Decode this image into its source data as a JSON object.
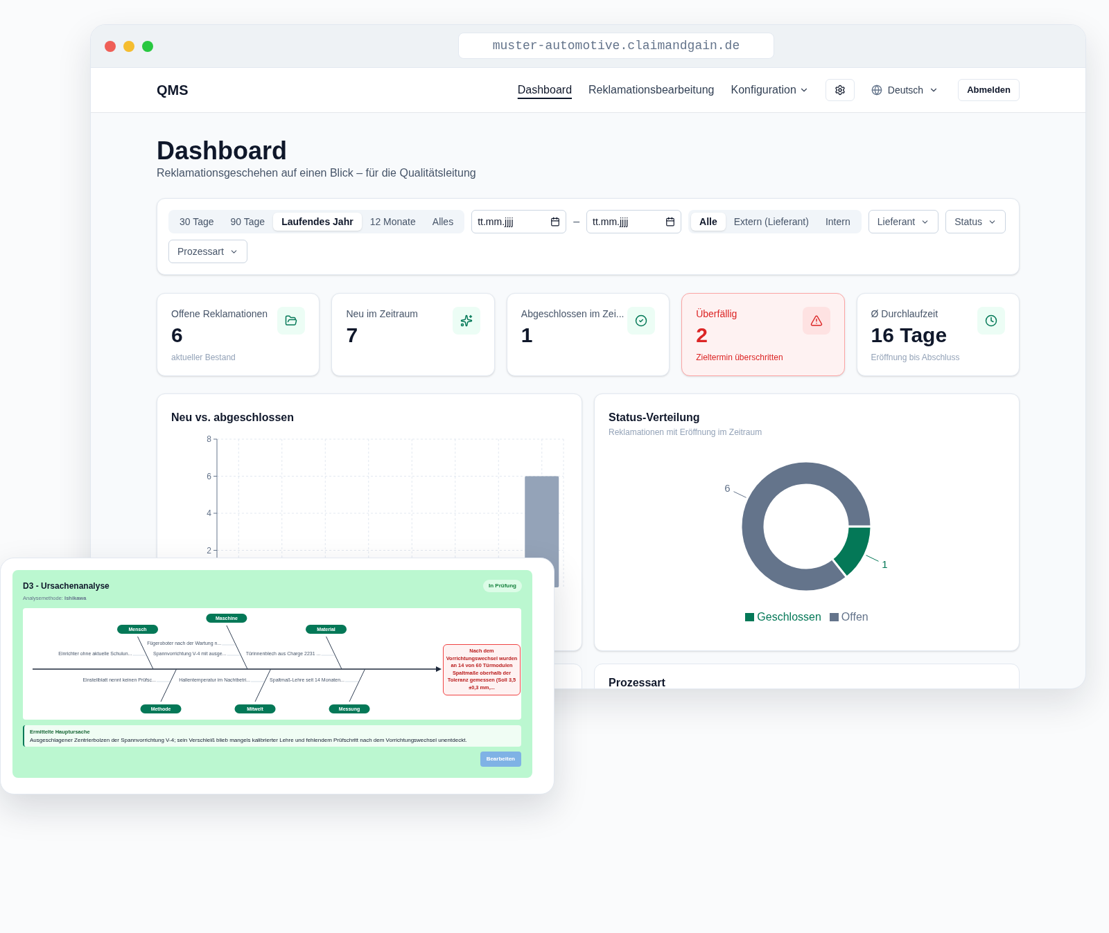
{
  "browser": {
    "url": "muster-automotive.claimandgain.de"
  },
  "nav": {
    "brand": "QMS",
    "items": [
      {
        "label": "Dashboard",
        "selected": true,
        "kind": "link"
      },
      {
        "label": "Reklamationsbearbeitung",
        "selected": false,
        "kind": "link"
      },
      {
        "label": "Konfiguration",
        "selected": false,
        "kind": "menu"
      }
    ],
    "language": "Deutsch",
    "logout": "Abmelden"
  },
  "page": {
    "title": "Dashboard",
    "subtitle": "Reklamationsgeschehen auf einen Blick – für die Qualitätsleitung"
  },
  "filters": {
    "periods": [
      {
        "label": "30 Tage",
        "selected": false
      },
      {
        "label": "90 Tage",
        "selected": false
      },
      {
        "label": "Laufendes Jahr",
        "selected": true
      },
      {
        "label": "12 Monate",
        "selected": false
      },
      {
        "label": "Alles",
        "selected": false
      }
    ],
    "date_from": {
      "placeholder": "tt.mm.jjjj"
    },
    "separator": "–",
    "date_to": {
      "placeholder": "tt.mm.jjjj"
    },
    "sources": [
      {
        "label": "Alle",
        "selected": true
      },
      {
        "label": "Extern (Lieferant)",
        "selected": false
      },
      {
        "label": "Intern",
        "selected": false
      }
    ],
    "dropdowns": [
      "Lieferant",
      "Status",
      "Prozessart"
    ]
  },
  "kpis": [
    {
      "title": "Offene Reklamationen",
      "value": "6",
      "note": "aktueller Bestand",
      "kind": "default"
    },
    {
      "title": "Neu im Zeitraum",
      "value": "7",
      "kind": "default"
    },
    {
      "title": "Abgeschlossen im Zei...",
      "value": "1",
      "kind": "default"
    },
    {
      "title": "Überfällig",
      "value": "2",
      "note": "Zieltermin überschritten",
      "kind": "danger"
    },
    {
      "title": "Ø Durchlaufzeit",
      "value": "16 Tage",
      "note": "Eröffnung bis Abschluss",
      "kind": "default"
    }
  ],
  "trend_card": {
    "title": "Neu vs. abgeschlossen",
    "chart_data": {
      "type": "bar",
      "grid": true,
      "ylim": [
        0,
        8
      ],
      "yticks": [
        {
          "value": 2,
          "label": "2"
        },
        {
          "value": 4,
          "label": "4"
        },
        {
          "value": 6,
          "label": "6"
        },
        {
          "value": 8,
          "label": "8"
        }
      ],
      "series": [
        {
          "color": "#94a3b8",
          "values": [
            null,
            null,
            null,
            null,
            null,
            null,
            null,
            6
          ]
        }
      ]
    }
  },
  "status_card": {
    "title": "Status-Verteilung",
    "subtitle": "Reklamationen mit Eröffnung im Zeitraum",
    "chart_data": {
      "type": "donut",
      "categories": [
        "Geschlossen",
        "Offen"
      ],
      "legend": "bottom",
      "data_labels": true,
      "series": [
        {
          "values": [
            1,
            6
          ]
        }
      ],
      "colors": [
        "#047857",
        "#64748b"
      ]
    }
  },
  "process_card": {
    "title": "Prozessart"
  },
  "analysis": {
    "title": "D3 - Ursachenanalyse",
    "status": "In Prüfung",
    "method": "Analysemethode: **Ishikawa**",
    "effect": "Nach dem Vorrichtungswechsel wurden an 14 von 60 Türmodulen Spaltmaße oberhalb der Toleranz gemessen (Soll 3,5 ±0,3 mm,...",
    "top_categories": [
      {
        "label": "Mensch",
        "causes": [
          "Einrichter ohne aktuelle Schulun..."
        ]
      },
      {
        "label": "Maschine",
        "causes": [
          "Fügeroboter nach der Wartung n...",
          "Spannvorrichtung V-4 mit ausge..."
        ]
      },
      {
        "label": "Material",
        "causes": [
          "Türinnenblech aus Charge 2231 ..."
        ]
      }
    ],
    "bottom_categories": [
      {
        "label": "Methode",
        "causes": [
          "Einstellblatt nennt keinen Prüfsc..."
        ]
      },
      {
        "label": "Mitwelt",
        "causes": [
          "Hallentemperatur im Nachtbetri..."
        ]
      },
      {
        "label": "Messung",
        "causes": [
          "Spaltmaß-Lehre seit 14 Monaten..."
        ]
      }
    ],
    "root_cause_label": "Ermittelte Hauptursache",
    "root_cause": "Ausgeschlagener Zentrierbolzen der Spannvorrichtung V-4; sein Verschleiß blieb mangels kalibrierter Lehre und fehlendem Prüfschritt nach dem Vorrichtungswechsel unentdeckt.",
    "edit_button": {
      "label": "Bearbeiten",
      "disabled": true
    }
  }
}
